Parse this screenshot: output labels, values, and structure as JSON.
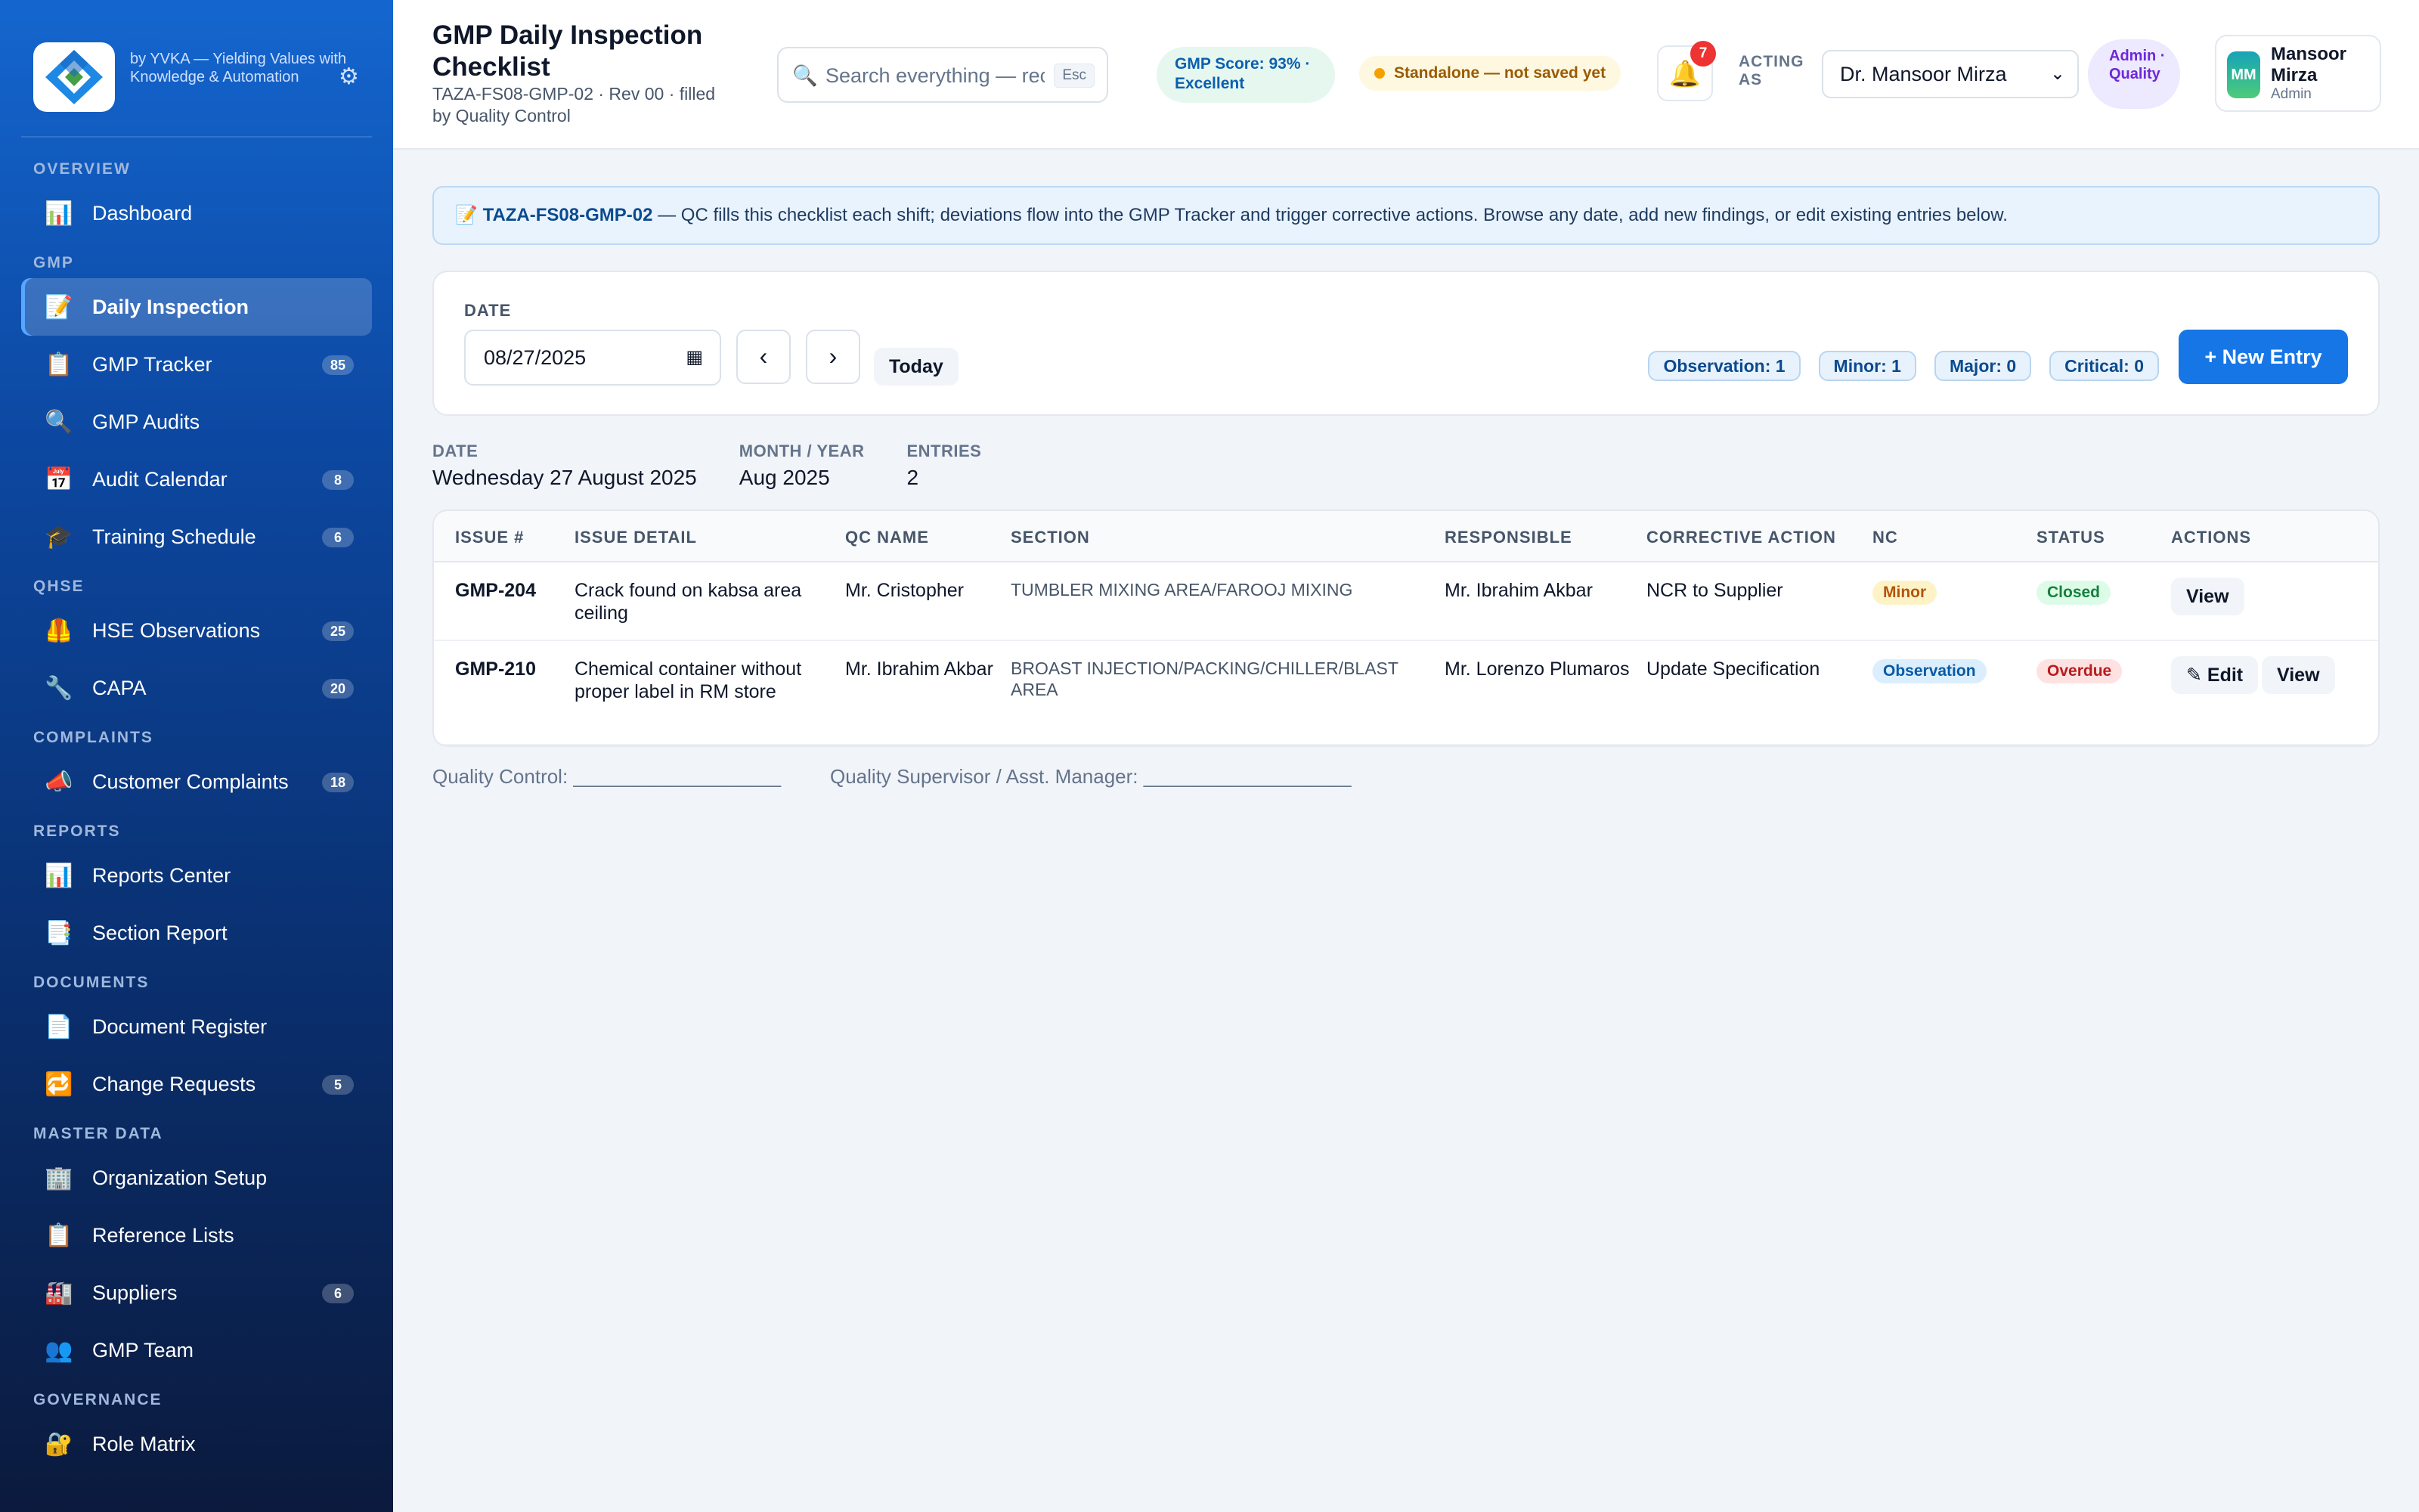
{
  "brand": {
    "tagline": "by YVKA — Yielding Values with Knowledge & Automation",
    "settings_icon": "gear-icon"
  },
  "sidebar": {
    "sections": [
      {
        "title": "OVERVIEW",
        "items": [
          {
            "icon": "📊",
            "label": "Dashboard",
            "badge": ""
          }
        ]
      },
      {
        "title": "GMP",
        "items": [
          {
            "icon": "📝",
            "label": "Daily Inspection",
            "badge": "",
            "active": true
          },
          {
            "icon": "📋",
            "label": "GMP Tracker",
            "badge": "85"
          },
          {
            "icon": "🔍",
            "label": "GMP Audits",
            "badge": ""
          },
          {
            "icon": "📅",
            "label": "Audit Calendar",
            "badge": "8"
          },
          {
            "icon": "🎓",
            "label": "Training Schedule",
            "badge": "6"
          }
        ]
      },
      {
        "title": "QHSE",
        "items": [
          {
            "icon": "🦺",
            "label": "HSE Observations",
            "badge": "25"
          },
          {
            "icon": "🔧",
            "label": "CAPA",
            "badge": "20"
          }
        ]
      },
      {
        "title": "COMPLAINTS",
        "items": [
          {
            "icon": "📣",
            "label": "Customer Complaints",
            "badge": "18"
          }
        ]
      },
      {
        "title": "REPORTS",
        "items": [
          {
            "icon": "📊",
            "label": "Reports Center",
            "badge": ""
          },
          {
            "icon": "📑",
            "label": "Section Report",
            "badge": ""
          }
        ]
      },
      {
        "title": "DOCUMENTS",
        "items": [
          {
            "icon": "📄",
            "label": "Document Register",
            "badge": ""
          },
          {
            "icon": "🔁",
            "label": "Change Requests",
            "badge": "5"
          }
        ]
      },
      {
        "title": "MASTER DATA",
        "items": [
          {
            "icon": "🏢",
            "label": "Organization Setup",
            "badge": ""
          },
          {
            "icon": "📋",
            "label": "Reference Lists",
            "badge": ""
          },
          {
            "icon": "🏭",
            "label": "Suppliers",
            "badge": "6"
          },
          {
            "icon": "👥",
            "label": "GMP Team",
            "badge": ""
          }
        ]
      },
      {
        "title": "GOVERNANCE",
        "items": [
          {
            "icon": "🔐",
            "label": "Role Matrix",
            "badge": ""
          }
        ]
      }
    ]
  },
  "header": {
    "title": "GMP Daily Inspection Checklist",
    "subtitle": "TAZA-FS08-GMP-02 · Rev 00 · filled by Quality Control",
    "search_placeholder": "Search everything — records",
    "search_kbd": "Esc",
    "score": "GMP Score: 93% · Excellent",
    "standalone": "Standalone — not saved yet",
    "notifications_count": "7",
    "acting_label": "ACTING AS",
    "acting_value": "Dr. Mansoor Mirza",
    "role_chip": "Admin · Quality",
    "user_initials": "MM",
    "user_name": "Mansoor Mirza",
    "user_role": "Admin"
  },
  "banner": {
    "icon": "📝",
    "code": "TAZA-FS08-GMP-02",
    "text": " — QC fills this checklist each shift; deviations flow into the GMP Tracker and trigger corrective actions. Browse any date, add new findings, or edit existing entries below."
  },
  "datecard": {
    "label": "DATE",
    "value": "08/27/2025",
    "prev": "‹",
    "next": "›",
    "today": "Today",
    "chips": [
      "Observation: 1",
      "Minor: 1",
      "Major: 0",
      "Critical: 0"
    ],
    "new_entry": "+  New Entry"
  },
  "summary": [
    {
      "label": "DATE",
      "value": "Wednesday 27 August 2025"
    },
    {
      "label": "MONTH / YEAR",
      "value": "Aug 2025"
    },
    {
      "label": "ENTRIES",
      "value": "2"
    }
  ],
  "table": {
    "columns": [
      "ISSUE #",
      "ISSUE DETAIL",
      "QC NAME",
      "SECTION",
      "RESPONSIBLE",
      "CORRECTIVE ACTION",
      "NC",
      "STATUS",
      "ACTIONS"
    ],
    "rows": [
      {
        "issue": "GMP-204",
        "detail": "Crack found on kabsa area ceiling",
        "qc": "Mr. Cristopher",
        "section": "TUMBLER MIXING AREA/FAROOJ MIXING",
        "responsible": "Mr. Ibrahim Akbar",
        "action": "NCR to Supplier",
        "nc": "Minor",
        "status": "Closed",
        "buttons": [
          "View"
        ]
      },
      {
        "issue": "GMP-210",
        "detail": "Chemical container without proper label in RM store",
        "qc": "Mr. Ibrahim Akbar",
        "section": "BROAST INJECTION/PACKING/CHILLER/BLAST AREA",
        "responsible": "Mr. Lorenzo Plumaros",
        "action": "Update Specification",
        "nc": "Observation",
        "status": "Overdue",
        "buttons": [
          "✎ Edit",
          "View"
        ]
      }
    ]
  },
  "signoff": {
    "qc": "Quality Control: ___________________",
    "supervisor": "Quality Supervisor / Asst. Manager: ___________________"
  }
}
